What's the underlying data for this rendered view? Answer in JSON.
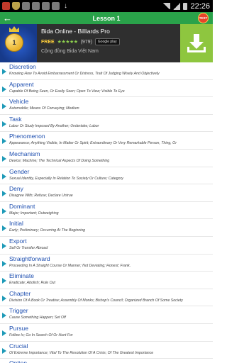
{
  "status_bar": {
    "time": "22:26",
    "icons": [
      "red-app-icon",
      "security-shield-icon",
      "notification-icon",
      "notification-icon",
      "notification-icon",
      "mail-icon",
      "download-icon"
    ]
  },
  "action_bar": {
    "title": "Lesson 1",
    "test_badge": "TEST",
    "accent_color": "#2aa24a"
  },
  "ad": {
    "ball_number": "1",
    "title": "Bida Online - Billiards Pro",
    "price": "FREE",
    "stars": "★★★★★",
    "rating_count": "(979)",
    "store_badge": "Google play",
    "subtitle": "Cộng đồng Bida Việt Nam",
    "button_color": "#8ec63f"
  },
  "words": [
    {
      "word": "Discretion",
      "definition": "Knowing How To Avoid Embarrassment Or Distress, Trait Of Judging Wisely And Objectively"
    },
    {
      "word": "Apparent",
      "definition": "Capable Of Being Seen, Or Easily Seen; Open To View; Visible To Eye"
    },
    {
      "word": "Vehicle",
      "definition": "Automobile; Means Of Conveying; Medium"
    },
    {
      "word": "Task",
      "definition": "Labor Or Study Imposed By Another; Undertake; Labor"
    },
    {
      "word": "Phenomenon",
      "definition": "Appearance; Anything Visible, In Matter Or Spirit; Extraordinary Or Very Remarkable Person, Thing, Or"
    },
    {
      "word": "Mechanism",
      "definition": "Device; Machine; The Technical Aspects Of Doing Something"
    },
    {
      "word": "Gender",
      "definition": "Sexual Identity, Especially In Relation To Society Or Culture; Category"
    },
    {
      "word": "Deny",
      "definition": "Disagree With; Refuse; Declare Untrue"
    },
    {
      "word": "Dominant",
      "definition": "Major; Important; Outweighing"
    },
    {
      "word": "Initial",
      "definition": "Early; Preliminary; Occurring At The Beginning"
    },
    {
      "word": "Export",
      "definition": "Sell Or Transfer Abroad"
    },
    {
      "word": "Straightforward",
      "definition": "Proceeding In A Straight Course Or Manner; Not Deviating; Honest; Frank."
    },
    {
      "word": "Eliminate",
      "definition": "Eradicate; Abolish; Rule Out"
    },
    {
      "word": "Chapter",
      "definition": "Division Of A Book Or Treatise; Assembly Of Monks; Bishop's Council; Organized Branch Of Some Society"
    },
    {
      "word": "Trigger",
      "definition": "Cause Something Happen; Set Off"
    },
    {
      "word": "Pursue",
      "definition": "Follow Is; Go In Search Of Or Hunt For"
    },
    {
      "word": "Crucial",
      "definition": "Of Extreme Importance; Vital To The Resolution Of A Crisis; Of The Greatest Importance"
    },
    {
      "word": "Option",
      "definition": "Act Of Choosing; Power Or Freedom To Choose"
    }
  ]
}
